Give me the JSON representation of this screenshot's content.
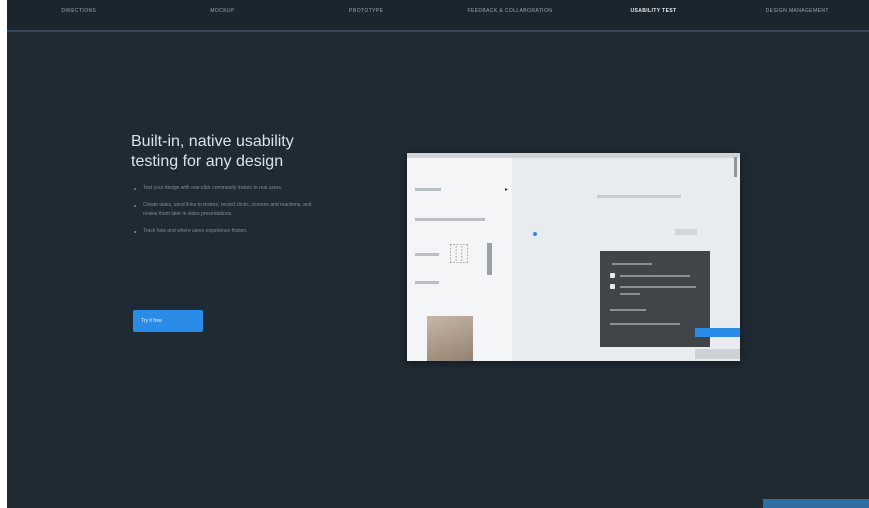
{
  "nav": {
    "items": [
      {
        "label": "Directions",
        "active": false
      },
      {
        "label": "Mockup",
        "active": false
      },
      {
        "label": "Prototype",
        "active": false
      },
      {
        "label": "Feedback & Collaboration",
        "active": false
      },
      {
        "label": "Usability Test",
        "active": true
      },
      {
        "label": "Design Management",
        "active": false
      }
    ]
  },
  "hero": {
    "title": "Built-in, native usability testing for any design",
    "bullets": [
      "Test your design with one-click community invites to real users.",
      "Create tasks, send links to testers, record clicks, screens and reactions, and review them later in video presentations.",
      "Track how and where users experience friction."
    ],
    "cta_label": "Try it free"
  },
  "preview": {
    "task_panel": {
      "accent_color": "#2a8ce6"
    }
  },
  "colors": {
    "background": "#1f2a33",
    "accent": "#2a8ce6"
  }
}
